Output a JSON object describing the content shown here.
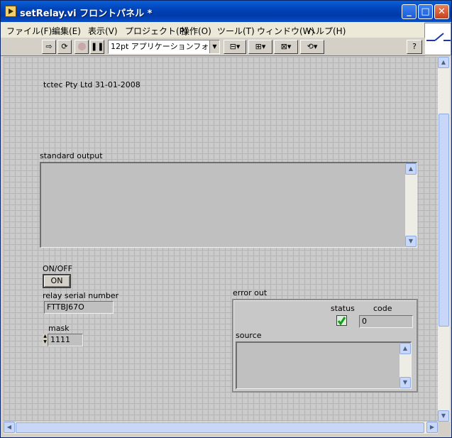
{
  "window": {
    "title": "setRelay.vi フロントパネル *"
  },
  "menu": [
    "ファイル(F)",
    "編集(E)",
    "表示(V)",
    "プロジェクト(P)",
    "操作(O)",
    "ツール(T)",
    "ウィンドウ(W)",
    "ヘルプ(H)"
  ],
  "toolbar": {
    "font": "12pt アプリケーションフォント",
    "help": "?"
  },
  "panel": {
    "caption": "tctec Pty Ltd 31-01-2008",
    "standard_output_label": "standard output",
    "standard_output_value": "",
    "onoff_label": "ON/OFF",
    "onoff_value": "ON",
    "serial_label": "relay serial number",
    "serial_value": "FTTBJ67O",
    "mask_label": "mask",
    "mask_value": "1111",
    "error_out": {
      "label": "error out",
      "status_label": "status",
      "code_label": "code",
      "code_value": "0",
      "source_label": "source",
      "source_value": ""
    }
  },
  "colors": {
    "titlebar": "#0043b8",
    "canvas": "#cbcbcb",
    "status_check": "#1c9a1c"
  }
}
